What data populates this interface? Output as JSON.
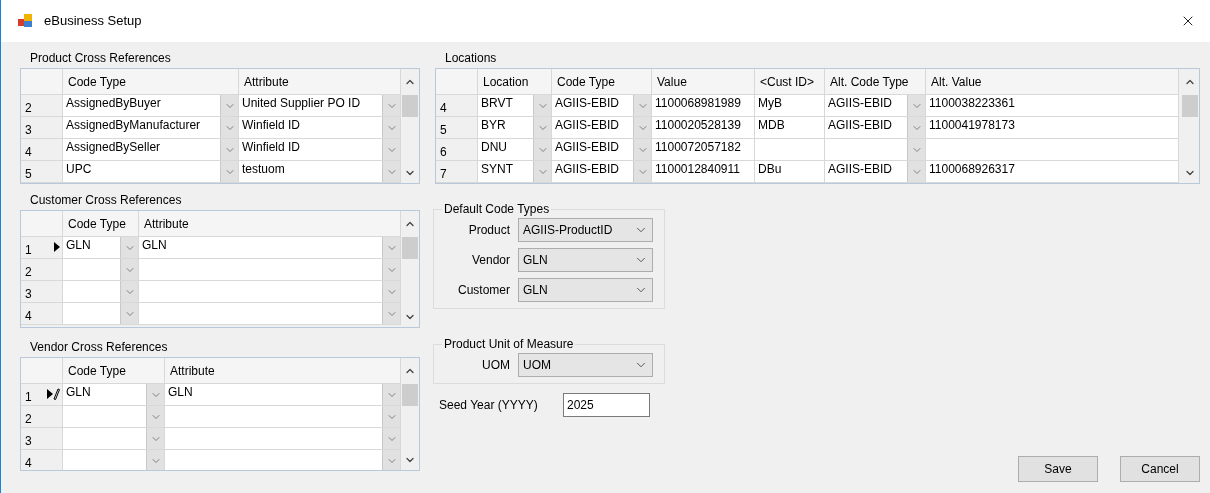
{
  "window": {
    "title": "eBusiness Setup"
  },
  "product_cross_references": {
    "title": "Product Cross References",
    "columns": [
      {
        "label": "Code Type",
        "kind": "combo"
      },
      {
        "label": "Attribute",
        "kind": "combo"
      }
    ],
    "rows": [
      {
        "number": "2",
        "current": false,
        "editing": false,
        "cells": [
          "AssignedByBuyer",
          "United Supplier PO ID"
        ]
      },
      {
        "number": "3",
        "current": false,
        "editing": false,
        "cells": [
          "AssignedByManufacturer",
          "Winfield ID"
        ]
      },
      {
        "number": "4",
        "current": false,
        "editing": false,
        "cells": [
          "AssignedBySeller",
          "Winfield ID"
        ]
      },
      {
        "number": "5",
        "current": false,
        "editing": false,
        "cells": [
          "UPC",
          "testuom"
        ]
      }
    ]
  },
  "customer_cross_references": {
    "title": "Customer Cross References",
    "columns": [
      {
        "label": "Code Type",
        "kind": "combo"
      },
      {
        "label": "Attribute",
        "kind": "combo"
      }
    ],
    "rows": [
      {
        "number": "1",
        "current": true,
        "editing": false,
        "cells": [
          "GLN",
          "GLN"
        ]
      },
      {
        "number": "2",
        "current": false,
        "editing": false,
        "cells": [
          null,
          null
        ]
      },
      {
        "number": "3",
        "current": false,
        "editing": false,
        "cells": [
          null,
          null
        ]
      },
      {
        "number": "4",
        "current": false,
        "editing": false,
        "cells": [
          null,
          null
        ]
      }
    ]
  },
  "vendor_cross_references": {
    "title": "Vendor Cross References",
    "columns": [
      {
        "label": "Code Type",
        "kind": "combo"
      },
      {
        "label": "Attribute",
        "kind": "combo"
      }
    ],
    "rows": [
      {
        "number": "1",
        "current": true,
        "editing": true,
        "cells": [
          "GLN",
          "GLN"
        ]
      },
      {
        "number": "2",
        "current": false,
        "editing": false,
        "cells": [
          null,
          null
        ]
      },
      {
        "number": "3",
        "current": false,
        "editing": false,
        "cells": [
          null,
          null
        ]
      },
      {
        "number": "4",
        "current": false,
        "editing": false,
        "cells": [
          null,
          null
        ]
      }
    ]
  },
  "locations": {
    "title": "Locations",
    "columns": [
      {
        "label": "Location",
        "kind": "combo"
      },
      {
        "label": "Code Type",
        "kind": "combo"
      },
      {
        "label": "Value",
        "kind": "text"
      },
      {
        "label": "<Cust ID>",
        "kind": "text"
      },
      {
        "label": "Alt. Code Type",
        "kind": "combo"
      },
      {
        "label": "Alt. Value",
        "kind": "text"
      }
    ],
    "rows": [
      {
        "number": "4",
        "current": false,
        "editing": false,
        "cells": [
          "BRVT",
          "AGIIS-EBID",
          "1100068981989",
          "MyB",
          "AGIIS-EBID",
          "1100038223361"
        ]
      },
      {
        "number": "5",
        "current": false,
        "editing": false,
        "cells": [
          "BYR",
          "AGIIS-EBID",
          "1100020528139",
          "MDB",
          "AGIIS-EBID",
          "1100041978173"
        ]
      },
      {
        "number": "6",
        "current": false,
        "editing": false,
        "cells": [
          "DNU",
          "AGIIS-EBID",
          "1100072057182",
          null,
          null,
          null
        ]
      },
      {
        "number": "7",
        "current": false,
        "editing": false,
        "cells": [
          "SYNT",
          "AGIIS-EBID",
          "1100012840911",
          "DBu",
          "AGIIS-EBID",
          "1100068926317"
        ]
      }
    ]
  },
  "default_code_types": {
    "title": "Default Code Types",
    "fields": [
      {
        "label": "Product",
        "value": "AGIIS-ProductID"
      },
      {
        "label": "Vendor",
        "value": "GLN"
      },
      {
        "label": "Customer",
        "value": "GLN"
      }
    ]
  },
  "product_unit_of_measure": {
    "title": "Product Unit of Measure",
    "fields": [
      {
        "label": "UOM",
        "value": "UOM"
      }
    ]
  },
  "seed_year": {
    "label": "Seed Year (YYYY)",
    "value": "2025"
  },
  "buttons": [
    "Save",
    "Cancel"
  ]
}
